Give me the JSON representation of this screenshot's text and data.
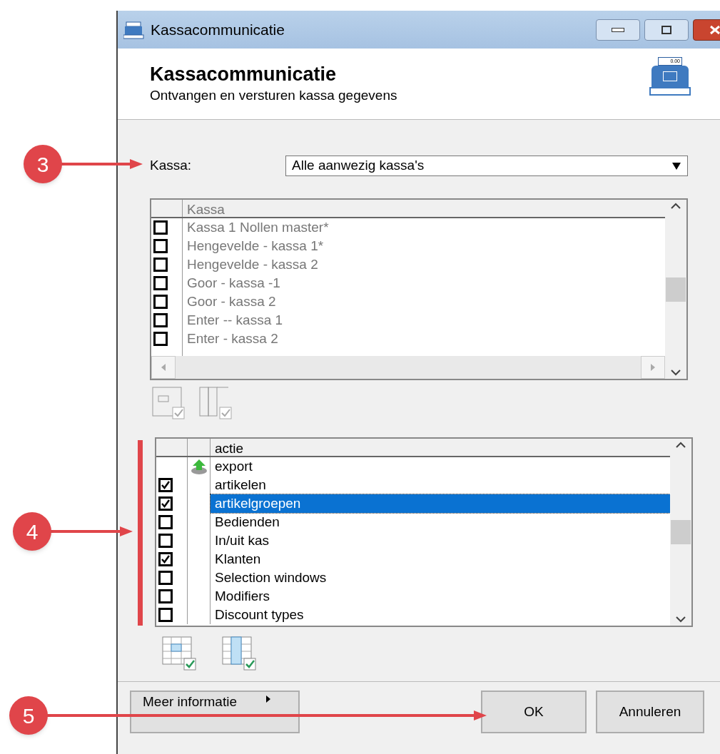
{
  "window": {
    "title": "Kassacommunicatie"
  },
  "header": {
    "title": "Kassacommunicatie",
    "subtitle": "Ontvangen en versturen kassa gegevens",
    "register_display": "0.00"
  },
  "kassa_select": {
    "label": "Kassa:",
    "value": "Alle aanwezig kassa's"
  },
  "kassa_list": {
    "column": "Kassa",
    "rows": [
      {
        "name": "Kassa 1 Nollen master*",
        "checked": false
      },
      {
        "name": "Hengevelde - kassa 1*",
        "checked": false
      },
      {
        "name": "Hengevelde - kassa 2",
        "checked": false
      },
      {
        "name": "Goor - kassa -1",
        "checked": false
      },
      {
        "name": "Goor - kassa 2",
        "checked": false
      },
      {
        "name": "Enter -- kassa 1",
        "checked": false
      },
      {
        "name": "Enter - kassa 2",
        "checked": false
      }
    ]
  },
  "actie_list": {
    "column": "actie",
    "rows": [
      {
        "kind": "group",
        "name": "export",
        "selected": false
      },
      {
        "kind": "item",
        "name": "artikelen",
        "checked": true,
        "selected": false
      },
      {
        "kind": "item",
        "name": "artikelgroepen",
        "checked": true,
        "selected": true
      },
      {
        "kind": "item",
        "name": "Bedienden",
        "checked": false,
        "selected": false
      },
      {
        "kind": "item",
        "name": "In/uit kas",
        "checked": false,
        "selected": false
      },
      {
        "kind": "item",
        "name": "Klanten",
        "checked": true,
        "selected": false
      },
      {
        "kind": "item",
        "name": "Selection windows",
        "checked": false,
        "selected": false
      },
      {
        "kind": "item",
        "name": "Modifiers",
        "checked": false,
        "selected": false
      },
      {
        "kind": "item",
        "name": "Discount types",
        "checked": false,
        "selected": false
      }
    ]
  },
  "buttons": [
    {
      "label": "Meer informatie",
      "kind": "more"
    },
    {
      "label": "OK",
      "kind": "ok"
    },
    {
      "label": "Annuleren",
      "kind": "cancel"
    }
  ],
  "annotations": [
    {
      "label": "3"
    },
    {
      "label": "4"
    },
    {
      "label": "5"
    }
  ]
}
